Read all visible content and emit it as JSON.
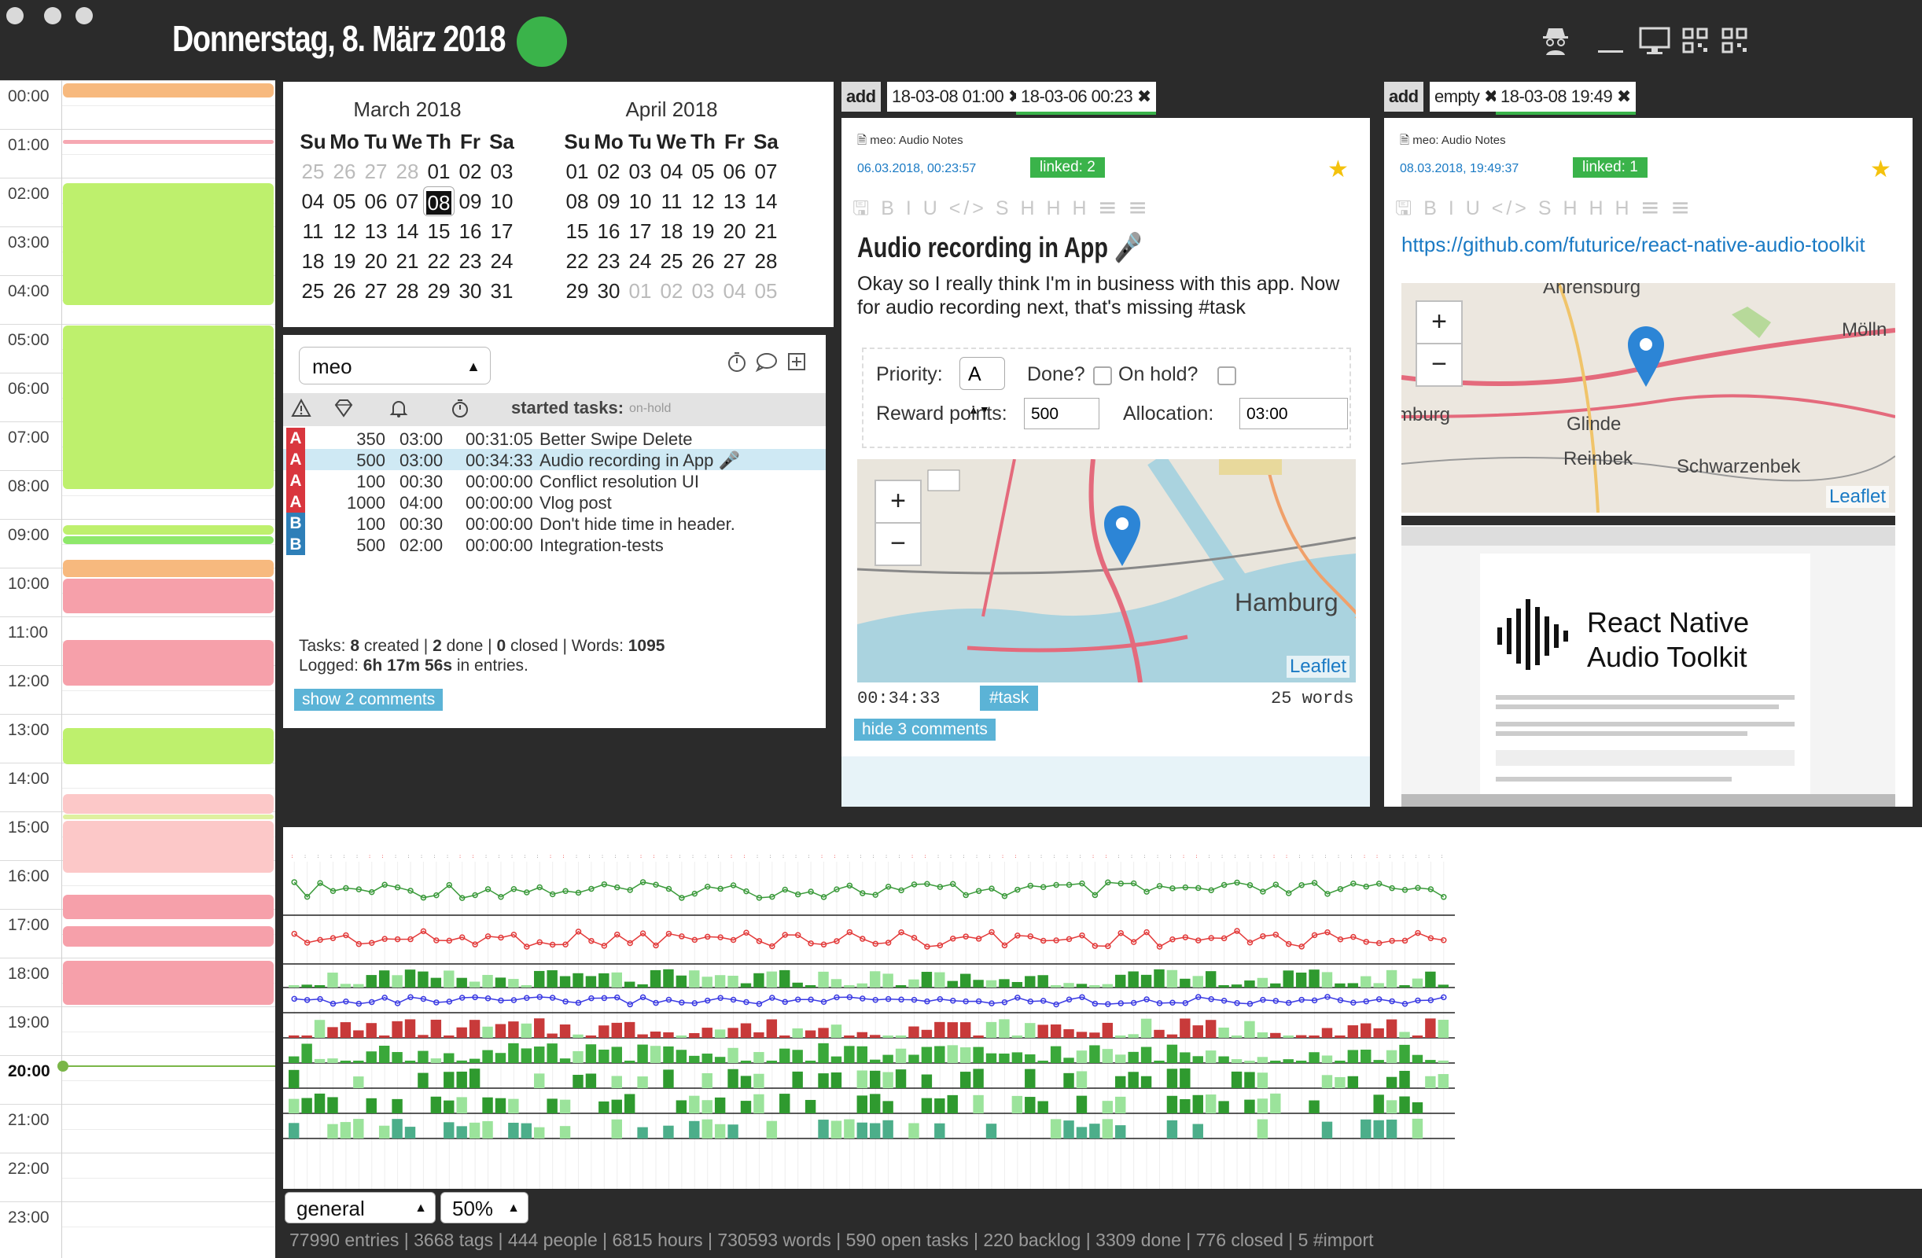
{
  "header": {
    "date": "Donnerstag, 8. März 2018",
    "icons": [
      "spy-icon",
      "minimize-icon",
      "monitor-icon",
      "qr-code-icon",
      "qr-code-icon"
    ]
  },
  "colors": {
    "accent": "#3ab34a",
    "priority_a": "#d9363e",
    "priority_b": "#2e7fb8",
    "highlight": "#cfe9f4",
    "tag": "#5bb3d6"
  },
  "day": {
    "hours": [
      "00:00",
      "01:00",
      "02:00",
      "03:00",
      "04:00",
      "05:00",
      "06:00",
      "07:00",
      "08:00",
      "09:00",
      "10:00",
      "11:00",
      "12:00",
      "13:00",
      "14:00",
      "15:00",
      "16:00",
      "17:00",
      "18:00",
      "19:00",
      "20:00",
      "21:00",
      "22:00",
      "23:00"
    ],
    "current_hour": "20:00"
  },
  "calendar": {
    "weekdays": [
      "Su",
      "Mo",
      "Tu",
      "We",
      "Th",
      "Fr",
      "Sa"
    ],
    "months": [
      {
        "title": "March 2018",
        "weeks": [
          [
            "25",
            "26",
            "27",
            "28",
            "01",
            "02",
            "03"
          ],
          [
            "04",
            "05",
            "06",
            "07",
            "08",
            "09",
            "10"
          ],
          [
            "11",
            "12",
            "13",
            "14",
            "15",
            "16",
            "17"
          ],
          [
            "18",
            "19",
            "20",
            "21",
            "22",
            "23",
            "24"
          ],
          [
            "25",
            "26",
            "27",
            "28",
            "29",
            "30",
            "31"
          ]
        ],
        "other_month_first": 4,
        "other_month_last": 0
      },
      {
        "title": "April 2018",
        "weeks": [
          [
            "01",
            "02",
            "03",
            "04",
            "05",
            "06",
            "07"
          ],
          [
            "08",
            "09",
            "10",
            "11",
            "12",
            "13",
            "14"
          ],
          [
            "15",
            "16",
            "17",
            "18",
            "19",
            "20",
            "21"
          ],
          [
            "22",
            "23",
            "24",
            "25",
            "26",
            "27",
            "28"
          ],
          [
            "29",
            "30",
            "01",
            "02",
            "03",
            "04",
            "05"
          ]
        ],
        "other_month_first": 0,
        "other_month_last": 5
      }
    ],
    "selected": "08"
  },
  "tasks": {
    "tag_filter": "meo",
    "header_label": "started tasks:",
    "header_sub": "on-hold",
    "rows": [
      {
        "priority": "A",
        "points": "350",
        "alloc": "03:00",
        "logged": "00:31:05",
        "title": "Better Swipe Delete",
        "selected": false
      },
      {
        "priority": "A",
        "points": "500",
        "alloc": "03:00",
        "logged": "00:34:33",
        "title": "Audio recording in App 🎤",
        "selected": true
      },
      {
        "priority": "A",
        "points": "100",
        "alloc": "00:30",
        "logged": "00:00:00",
        "title": "Conflict resolution UI",
        "selected": false
      },
      {
        "priority": "A",
        "points": "1000",
        "alloc": "04:00",
        "logged": "00:00:00",
        "title": "Vlog post",
        "selected": false
      },
      {
        "priority": "B",
        "points": "100",
        "alloc": "00:30",
        "logged": "00:00:00",
        "title": "Don't hide time in header.",
        "selected": false
      },
      {
        "priority": "B",
        "points": "500",
        "alloc": "02:00",
        "logged": "00:00:00",
        "title": "Integration-tests",
        "selected": false
      }
    ],
    "stats_line1_a": "Tasks: ",
    "stats_created": "8",
    "stats_line1_b": " created | ",
    "stats_done": "2",
    "stats_line1_c": " done | ",
    "stats_closed": "0",
    "stats_line1_d": " closed | Words: ",
    "stats_words": "1095",
    "stats_line2_a": "Logged: ",
    "stats_logged": "6h 17m 56s",
    "stats_line2_b": " in entries.",
    "show_comments": "show 2 comments"
  },
  "entry1": {
    "tabs": [
      "add",
      "18-03-08 01:00",
      "18-03-06 00:23"
    ],
    "category": "meo: Audio Notes",
    "timestamp": "06.03.2018, 00:23:57",
    "linked": "linked: 2",
    "title": "Audio recording in App 🎤",
    "body": "Okay so I really think I'm in business with this app. Now for audio recording next, that's missing #task",
    "priority_label": "Priority:",
    "priority_value": "A",
    "done_label": "Done?",
    "onhold_label": "On hold?",
    "reward_label": "Reward points:",
    "reward_value": "500",
    "allocation_label": "Allocation:",
    "allocation_value": "03:00",
    "map_city": "Hamburg",
    "map_attribution": "Leaflet",
    "duration": "00:34:33",
    "hashtag": "#task",
    "words": "25 words",
    "hide_comments": "hide 3 comments"
  },
  "entry2": {
    "tabs": [
      "add",
      "empty",
      "18-03-08 19:49"
    ],
    "category": "meo: Audio Notes",
    "timestamp": "08.03.2018, 19:49:37",
    "linked": "linked: 1",
    "url": "https://github.com/futurice/react-native-audio-toolkit",
    "map_places": [
      "Ahrensburg",
      "Mölln",
      "Glinde",
      "Reinbek",
      "Schwarzenbek",
      "mburg"
    ],
    "map_attribution": "Leaflet",
    "screenshot_title": "React Native Audio Toolkit"
  },
  "toolbar_glyphs": "🖫 B I U </> S H H H ☰ ☰",
  "bottom": {
    "dashboard_select": "general",
    "zoom_select": "50%",
    "stats": "77990 entries | 3668 tags | 444 people | 6815 hours | 730593 words | 590 open tasks | 220 backlog | 3309 done | 776 closed | 5 #import"
  },
  "chart_data": {
    "type": "line",
    "title": "",
    "rows": [
      {
        "kind": "line",
        "color": "#3a9a3a"
      },
      {
        "kind": "line",
        "color": "#e33a3a"
      },
      {
        "kind": "bar",
        "color": "#2f9a2f"
      },
      {
        "kind": "line",
        "color": "#3a3ae3"
      },
      {
        "kind": "bar",
        "color": "#c83a3a"
      },
      {
        "kind": "bar",
        "color": "#3aa83a"
      },
      {
        "kind": "bar",
        "color": "#2f9a2f"
      },
      {
        "kind": "bar",
        "color": "#2f9a2f"
      },
      {
        "kind": "bar",
        "color": "#4cae8a"
      }
    ],
    "days": 90
  }
}
